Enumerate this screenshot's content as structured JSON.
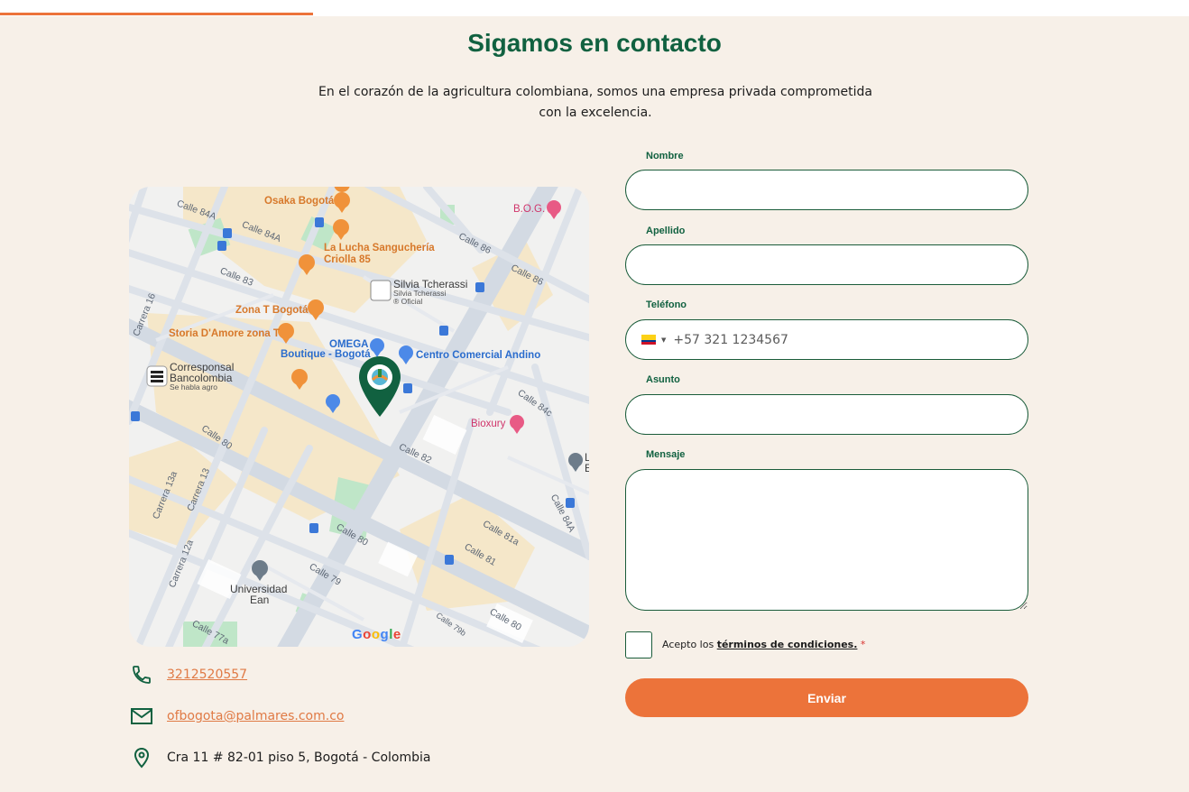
{
  "header": {
    "title": "Sigamos en contacto",
    "subtitle": "En el corazón de la agricultura colombiana, somos una empresa privada comprometida con la excelencia."
  },
  "map": {
    "places": {
      "osaka": "Osaka Bogotá",
      "lucha": "La Lucha Sanguchería Criolla 85",
      "zonat": "Zona T Bogotá",
      "storia": "Storia D'Amore zona T",
      "silvia_title": "Silvia Tcherassi",
      "silvia_sub1": "Silvia Tcherassi",
      "silvia_sub2": "® Oficial",
      "omega1": "OMEGA",
      "omega2": "Boutique - Bogotá",
      "andino": "Centro Comercial Andino",
      "bog": "B.O.G.",
      "bancolombia1": "Corresponsal",
      "bancolombia2": "Bancolombia",
      "bancolombia3": "Se habla agro",
      "bioxury": "Bioxury",
      "ean1": "Universidad",
      "ean2": "Ean",
      "le": "L",
      "le2": "E"
    },
    "streets": {
      "calle84a_1": "Calle 84A",
      "calle84a_2": "Calle 84A",
      "calle83": "Calle 83",
      "calle86_1": "Calle 86",
      "calle86_2": "Calle 86",
      "carrera16": "Carrera 16",
      "calle84c": "Calle 84c",
      "calle80_1": "Calle 80",
      "calle80_2": "Calle 80",
      "calle80_3": "Calle 80",
      "calle82": "Calle 82",
      "carrera13a": "Carrera 13a",
      "carrera13": "Carrera 13",
      "carrera12a": "Carrera 12a",
      "calle81a": "Calle 81a",
      "calle81": "Calle 81",
      "calle84a_3": "Calle 84A",
      "calle79": "Calle 79",
      "calle79b": "Calle 79b",
      "calle77a": "Calle 77a"
    },
    "google": "Google"
  },
  "contact": {
    "phone": "3212520557",
    "email": "ofbogota@palmares.com.co",
    "address": "Cra 11 # 82-01 piso 5, Bogotá - Colombia"
  },
  "form": {
    "nombre_label": "Nombre",
    "apellido_label": "Apellido",
    "telefono_label": "Teléfono",
    "telefono_placeholder": "+57 321 1234567",
    "asunto_label": "Asunto",
    "mensaje_label": "Mensaje",
    "terms_prefix": "Acepto los ",
    "terms_link": "términos de condiciones.",
    "terms_required": "*",
    "submit_label": "Enviar"
  },
  "icons": {
    "phone": "phone-icon",
    "email": "mail-icon",
    "address": "location-pin-icon"
  },
  "colors": {
    "brand_green": "#116140",
    "accent_orange": "#ec733a",
    "background": "#f7f0e8"
  }
}
